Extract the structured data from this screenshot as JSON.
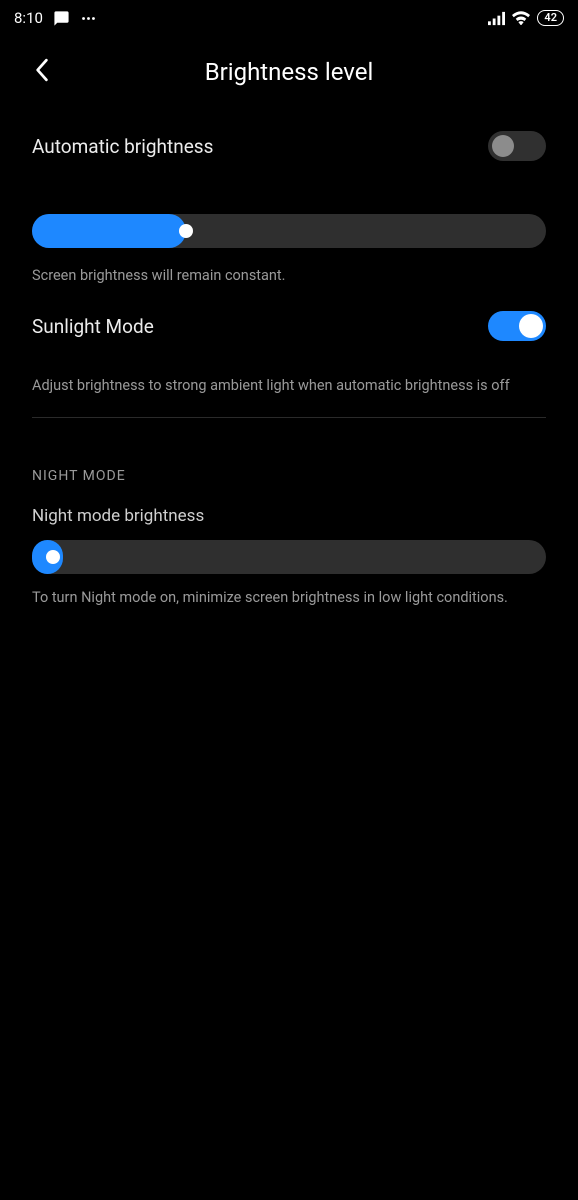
{
  "status": {
    "time": "8:10",
    "battery": "42"
  },
  "header": {
    "title": "Brightness level"
  },
  "auto_brightness": {
    "label": "Automatic brightness",
    "enabled": false,
    "slider_percent": 30,
    "desc": "Screen brightness will remain constant."
  },
  "sunlight_mode": {
    "label": "Sunlight Mode",
    "enabled": true,
    "desc": "Adjust brightness to strong ambient light when automatic brightness is off"
  },
  "night_mode": {
    "section": "NIGHT MODE",
    "label": "Night mode brightness",
    "slider_percent": 4,
    "desc": "To turn Night mode on, minimize screen brightness in low light conditions."
  },
  "colors": {
    "accent": "#1e88ff"
  }
}
